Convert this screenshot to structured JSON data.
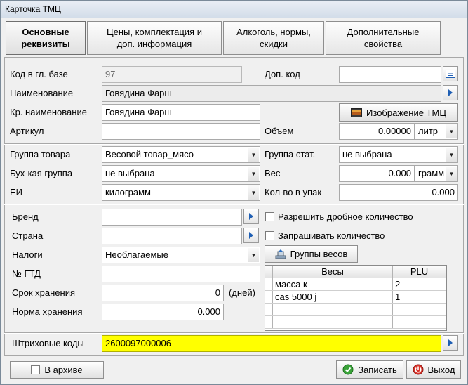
{
  "window": {
    "title": "Карточка ТМЦ"
  },
  "tabs": [
    {
      "label_l1": "Основные",
      "label_l2": "реквизиты"
    },
    {
      "label_l1": "Цены, комплектация и",
      "label_l2": "доп.  информация"
    },
    {
      "label_l1": "Алкоголь, нормы,",
      "label_l2": "скидки"
    },
    {
      "label_l1": "Дополнительные",
      "label_l2": "свойства"
    }
  ],
  "fields": {
    "code_label": "Код в гл. базе",
    "code_value": "97",
    "addcode_label": "Доп. код",
    "addcode_value": "",
    "name_label": "Наименование",
    "name_value": "Говядина Фарш",
    "shortname_label": "Кр. наименование",
    "shortname_value": "Говядина Фарш",
    "image_button": "Изображение ТМЦ",
    "article_label": "Артикул",
    "article_value": "",
    "volume_label": "Объем",
    "volume_value": "0.00000",
    "volume_unit": "литр",
    "group_label": "Группа товара",
    "group_value": "Весовой товар_мясо",
    "statgroup_label": "Группа стат.",
    "statgroup_value": "не выбрана",
    "accgroup_label": "Бух-кая группа",
    "accgroup_value": "не выбрана",
    "weight_label": "Вес",
    "weight_value": "0.000",
    "weight_unit": "грамм",
    "unit_label": "ЕИ",
    "unit_value": "килограмм",
    "packqty_label": "Кол-во в упак",
    "packqty_value": "0.000",
    "brand_label": "Бренд",
    "brand_value": "",
    "country_label": "Страна",
    "country_value": "",
    "tax_label": "Налоги",
    "tax_value": "Необлагаемые",
    "gtd_label": "№ ГТД",
    "gtd_value": "",
    "shelflife_label": "Срок хранения",
    "shelflife_value": "0",
    "shelflife_unit": "(дней)",
    "storage_label": "Норма хранения",
    "storage_value": "0.000",
    "fractional_label": "Разрешить дробное количество",
    "askqty_label": "Запрашивать количество",
    "scalegroups_button": "Группы весов",
    "barcode_label": "Штриховые коды",
    "barcode_value": "2600097000006"
  },
  "scales_table": {
    "headers": [
      "Весы",
      "PLU"
    ],
    "rows": [
      {
        "scale": "масса к",
        "plu": "2"
      },
      {
        "scale": "cas 5000 j",
        "plu": "1"
      }
    ]
  },
  "footer": {
    "archive_label": "В архиве",
    "save_label": "Записать",
    "exit_label": "Выход"
  }
}
